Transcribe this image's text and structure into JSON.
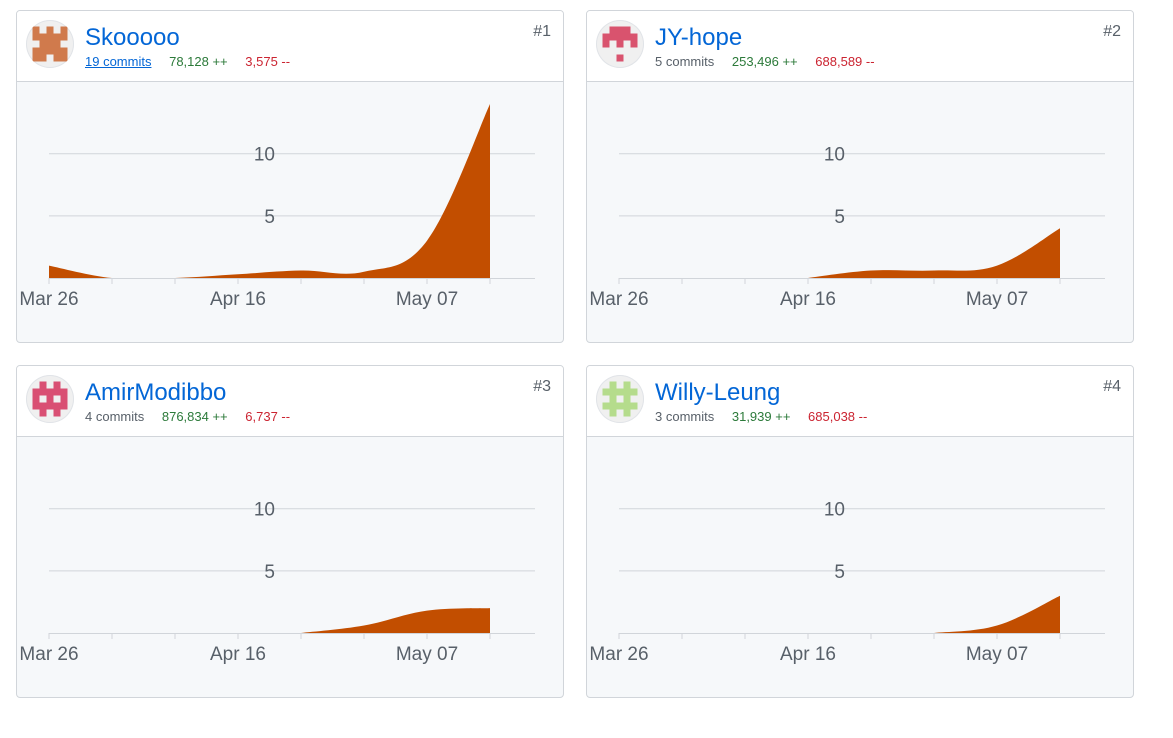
{
  "contributors": [
    {
      "username": "Skooooo",
      "commits": "19 commits",
      "commits_is_link": true,
      "additions": "78,128 ++",
      "deletions": "3,575 --",
      "rank": "#1",
      "avatar": {
        "color": "#d07a4c",
        "pattern": [
          "10101",
          "11111",
          "01110",
          "11111",
          "11011"
        ]
      }
    },
    {
      "username": "JY-hope",
      "commits": "5 commits",
      "commits_is_link": false,
      "additions": "253,496 ++",
      "deletions": "688,589 --",
      "rank": "#2",
      "avatar": {
        "color": "#d9536e",
        "pattern": [
          "01110",
          "11111",
          "10101",
          "00000",
          "00100"
        ]
      }
    },
    {
      "username": "AmirModibbo",
      "commits": "4 commits",
      "commits_is_link": false,
      "additions": "876,834 ++",
      "deletions": "6,737 --",
      "rank": "#3",
      "avatar": {
        "color": "#d94f73",
        "pattern": [
          "01010",
          "11111",
          "10101",
          "11111",
          "01010"
        ]
      }
    },
    {
      "username": "Willy-Leung",
      "commits": "3 commits",
      "commits_is_link": false,
      "additions": "31,939 ++",
      "deletions": "685,038 --",
      "rank": "#4",
      "avatar": {
        "color": "#b5dc8c",
        "pattern": [
          "01010",
          "11111",
          "01010",
          "11111",
          "01010"
        ]
      }
    }
  ],
  "colors": {
    "area_fill": "#c24e00",
    "gridline": "#d1d5da",
    "link": "#0366d6",
    "additions": "#2c7a3a",
    "deletions": "#cb2431"
  },
  "chart_data": [
    {
      "type": "area",
      "x_tick_labels": [
        "Mar 26",
        "Apr 16",
        "May 07"
      ],
      "x_ticks": [
        "2017-03-26",
        "2017-04-02",
        "2017-04-09",
        "2017-04-16",
        "2017-04-23",
        "2017-04-30",
        "2017-05-07",
        "2017-05-14"
      ],
      "y_tick_labels": [
        "5",
        "10"
      ],
      "ylim": [
        0,
        14
      ],
      "x": [
        "2017-03-26",
        "2017-04-02",
        "2017-04-09",
        "2017-04-16",
        "2017-04-23",
        "2017-04-30",
        "2017-05-07",
        "2017-05-14"
      ],
      "values": [
        1,
        0,
        0,
        0.3,
        0.6,
        0.5,
        3,
        14
      ]
    },
    {
      "type": "area",
      "x_tick_labels": [
        "Mar 26",
        "Apr 16",
        "May 07"
      ],
      "x_ticks": [
        "2017-03-26",
        "2017-04-02",
        "2017-04-09",
        "2017-04-16",
        "2017-04-23",
        "2017-04-30",
        "2017-05-07",
        "2017-05-14"
      ],
      "y_tick_labels": [
        "5",
        "10"
      ],
      "ylim": [
        0,
        14
      ],
      "x": [
        "2017-04-16",
        "2017-04-23",
        "2017-04-30",
        "2017-05-07",
        "2017-05-14"
      ],
      "values": [
        0,
        0.6,
        0.6,
        1,
        4
      ]
    },
    {
      "type": "area",
      "x_tick_labels": [
        "Mar 26",
        "Apr 16",
        "May 07"
      ],
      "x_ticks": [
        "2017-03-26",
        "2017-04-02",
        "2017-04-09",
        "2017-04-16",
        "2017-04-23",
        "2017-04-30",
        "2017-05-07",
        "2017-05-14"
      ],
      "y_tick_labels": [
        "5",
        "10"
      ],
      "ylim": [
        0,
        14
      ],
      "x": [
        "2017-04-23",
        "2017-04-30",
        "2017-05-07",
        "2017-05-14"
      ],
      "values": [
        0,
        0.6,
        1.8,
        2
      ]
    },
    {
      "type": "area",
      "x_tick_labels": [
        "Mar 26",
        "Apr 16",
        "May 07"
      ],
      "x_ticks": [
        "2017-03-26",
        "2017-04-02",
        "2017-04-09",
        "2017-04-16",
        "2017-04-23",
        "2017-04-30",
        "2017-05-07",
        "2017-05-14"
      ],
      "y_tick_labels": [
        "5",
        "10"
      ],
      "ylim": [
        0,
        14
      ],
      "x": [
        "2017-04-30",
        "2017-05-07",
        "2017-05-14"
      ],
      "values": [
        0,
        0.6,
        3
      ]
    }
  ]
}
